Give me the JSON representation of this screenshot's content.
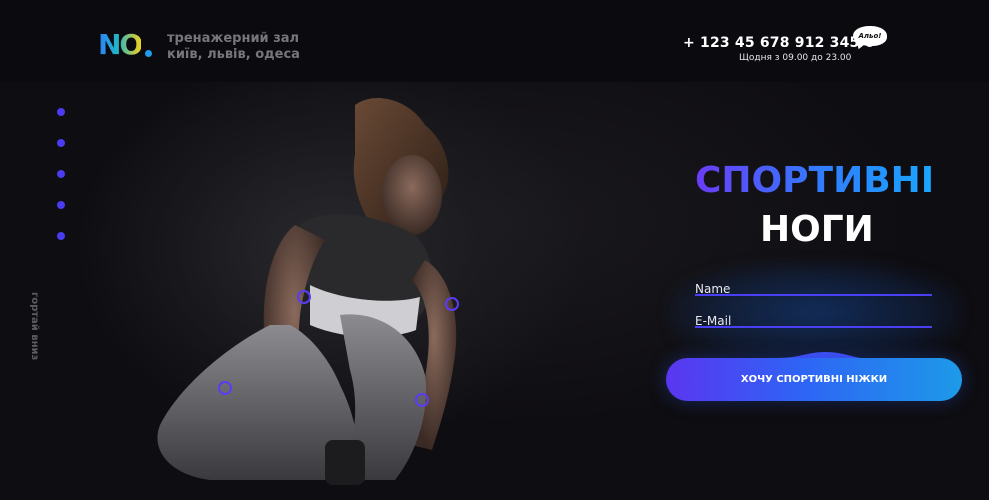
{
  "brand": {
    "logo_text": "NO"
  },
  "header": {
    "tagline_line1": "тренажерний зал",
    "tagline_line2": "київ, львів, одеса",
    "phone": "+ 123 45 678 912 345 6",
    "hours": "Щодня з 09.00 до 23.00",
    "bubble": "Альо!"
  },
  "side_nav": {
    "dots": 5,
    "scroll_label": "гортай вниз"
  },
  "hero": {
    "heading_line1": "СПОРТИВНІ",
    "heading_line2": "НОГИ"
  },
  "form": {
    "name_placeholder": "Name",
    "email_placeholder": "E-Mail",
    "submit_label": "ХОЧУ СПОРТИВНІ НІЖКИ"
  },
  "colors": {
    "background": "#0d0c10",
    "accent_violet": "#4a3cf0",
    "accent_blue": "#1d9ae8",
    "muted_text": "#77767b"
  }
}
